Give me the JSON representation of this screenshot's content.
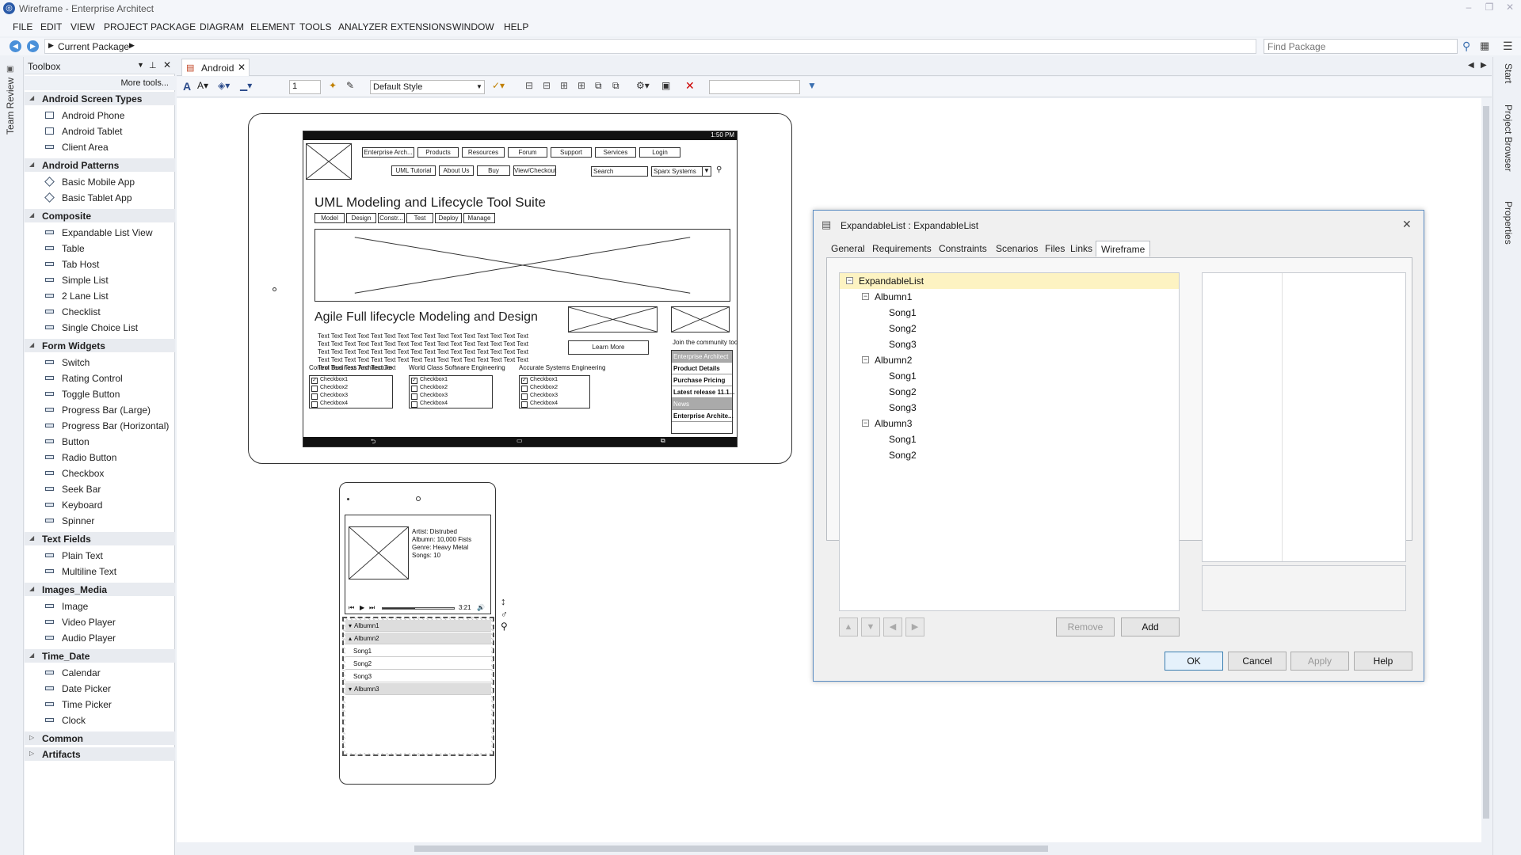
{
  "window": {
    "title": "Wireframe - Enterprise Architect"
  },
  "menu": [
    "FILE",
    "EDIT",
    "VIEW",
    "PROJECT",
    "PACKAGE",
    "DIAGRAM",
    "ELEMENT",
    "TOOLS",
    "ANALYZER",
    "EXTENSIONS",
    "WINDOW",
    "HELP"
  ],
  "nav": {
    "path": "Current Package",
    "find_placeholder": "Find Package"
  },
  "left_strip": {
    "label": "Team Review"
  },
  "right_strip": {
    "start": "Start",
    "project_browser": "Project Browser",
    "properties": "Properties"
  },
  "toolbox": {
    "title": "Toolbox",
    "more_tools": "More tools...",
    "categories": [
      {
        "name": "Android Screen Types",
        "items": [
          "Android Phone",
          "Android Tablet",
          "Client Area"
        ]
      },
      {
        "name": "Android Patterns",
        "items": [
          "Basic Mobile App",
          "Basic Tablet App"
        ]
      },
      {
        "name": "Composite",
        "items": [
          "Expandable List View",
          "Table",
          "Tab Host",
          "Simple List",
          "2 Lane List",
          "Checklist",
          "Single Choice List"
        ]
      },
      {
        "name": "Form Widgets",
        "items": [
          "Switch",
          "Rating Control",
          "Toggle Button",
          "Progress Bar (Large)",
          "Progress Bar (Horizontal)",
          "Button",
          "Radio Button",
          "Checkbox",
          "Seek Bar",
          "Keyboard",
          "Spinner"
        ]
      },
      {
        "name": "Text Fields",
        "items": [
          "Plain Text",
          "Multiline Text"
        ]
      },
      {
        "name": "Images_Media",
        "items": [
          "Image",
          "Video Player",
          "Audio Player"
        ]
      },
      {
        "name": "Time_Date",
        "items": [
          "Calendar",
          "Date Picker",
          "Time Picker",
          "Clock"
        ]
      },
      {
        "name": "Common",
        "items": []
      },
      {
        "name": "Artifacts",
        "items": []
      }
    ]
  },
  "diagram_tab": {
    "label": "Android"
  },
  "toolbar": {
    "zoom_value": "1",
    "style": "Default Style"
  },
  "tablet": {
    "status": "1:50 PM",
    "nav_row1": [
      "Enterprise Arch...",
      "Products",
      "Resources",
      "Forum",
      "Support",
      "Services",
      "Login"
    ],
    "nav_row2": [
      "UML Tutorial",
      "About Us",
      "Buy",
      "View/Checkout"
    ],
    "search": "Search",
    "search_combo": "Sparx Systems",
    "heading": "UML Modeling and Lifecycle Tool Suite",
    "tabs": [
      "Model",
      "Design",
      "Constr...",
      "Test",
      "Deploy",
      "Manage"
    ],
    "heading2": "Agile Full lifecycle Modeling and Design",
    "body_text_line": "Text Text Text Text Text Text Text Text Text Text Text Text Text Text Text Text",
    "body_text_last": "Text Text Text Text Text Text",
    "learn_more": "Learn More",
    "join": "Join the community too",
    "side_list": [
      "Enterprise Architect",
      "Product Details",
      "Purchase  Pricing",
      "Latest release 11.1...",
      "News",
      "Enterprise Archite..."
    ],
    "groups": [
      {
        "title": "Control Business Architecture",
        "checks": [
          "Checkbox1",
          "Checkbox2",
          "Checkbox3",
          "Checkbox4"
        ]
      },
      {
        "title": "World Class Software Engineering",
        "checks": [
          "Checkbox1",
          "Checkbox2",
          "Checkbox3",
          "Checkbox4"
        ]
      },
      {
        "title": "Accurate Systems Engineering",
        "checks": [
          "Checkbox1",
          "Checkbox2",
          "Checkbox3",
          "Checkbox4"
        ]
      }
    ],
    "checked_first": true
  },
  "phone": {
    "artist": "Artist: Distrubed",
    "albums": "Albumn: 10,000 Fists",
    "genre": "Genre: Heavy Metal",
    "songs": "Songs: 10",
    "time": "3:21",
    "progress": 0.45,
    "list": [
      "Albumn1",
      "Albumn2",
      "Song1",
      "Song2",
      "Song3",
      "Albumn3"
    ]
  },
  "dialog": {
    "title": "ExpandableList : ExpandableList",
    "tabs": [
      "General",
      "Requirements",
      "Constraints",
      "Scenarios",
      "Files",
      "Links",
      "Wireframe"
    ],
    "active_tab": "Wireframe",
    "tree": {
      "root": "ExpandableList",
      "albums": [
        {
          "name": "Albumn1",
          "songs": [
            "Song1",
            "Song2",
            "Song3"
          ]
        },
        {
          "name": "Albumn2",
          "songs": [
            "Song1",
            "Song2",
            "Song3"
          ]
        },
        {
          "name": "Albumn3",
          "songs": [
            "Song1",
            "Song2"
          ]
        }
      ]
    },
    "remove": "Remove",
    "add": "Add",
    "ok": "OK",
    "cancel": "Cancel",
    "apply": "Apply",
    "help": "Help"
  },
  "colors": {
    "accent": "#4a90d9",
    "tree_selected": "#fdf3c2",
    "dialog_border": "#5b8cc2"
  }
}
